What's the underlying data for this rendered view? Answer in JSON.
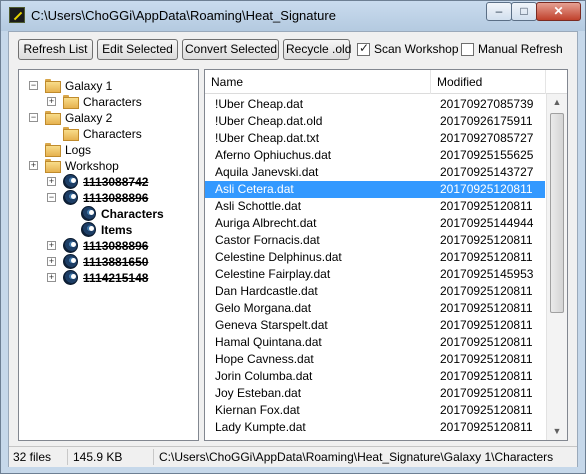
{
  "window": {
    "title": "C:\\Users\\ChoGGi\\AppData\\Roaming\\Heat_Signature",
    "controls": {
      "minimize": "–",
      "maximize": "□",
      "close": "✕"
    }
  },
  "toolbar": {
    "refresh_label": "Refresh List",
    "edit_label": "Edit Selected",
    "convert_label": "Convert Selected",
    "recycle_label": "Recycle .old",
    "scan_workshop": {
      "label": "Scan Workshop",
      "checked": true
    },
    "manual_refresh": {
      "label": "Manual Refresh",
      "checked": false
    }
  },
  "tree": [
    {
      "label": "Galaxy 1",
      "icon": "folder-icon",
      "expander": "−"
    },
    {
      "label": "Characters",
      "icon": "folder-icon",
      "expander": "+"
    },
    {
      "label": "Galaxy 2",
      "icon": "folder-icon",
      "expander": "−"
    },
    {
      "label": "Characters",
      "icon": "folder-icon",
      "expander": ""
    },
    {
      "label": "Logs",
      "icon": "folder-icon",
      "expander": ""
    },
    {
      "label": "Workshop",
      "icon": "folder-icon",
      "expander": "+"
    },
    {
      "label": "1113088742",
      "icon": "steam-icon",
      "expander": "+"
    },
    {
      "label": "1113088896",
      "icon": "steam-icon",
      "expander": "−"
    },
    {
      "label": "Characters",
      "icon": "steam-icon",
      "expander": ""
    },
    {
      "label": "Items",
      "icon": "steam-icon",
      "expander": ""
    },
    {
      "label": "1113088896",
      "icon": "steam-icon",
      "expander": "+"
    },
    {
      "label": "1113881650",
      "icon": "steam-icon",
      "expander": "+"
    },
    {
      "label": "1114215148",
      "icon": "steam-icon",
      "expander": "+"
    }
  ],
  "list": {
    "columns": [
      "Name",
      "Modified"
    ],
    "rows": [
      [
        "!Uber Cheap.dat",
        "20170927085739"
      ],
      [
        "!Uber Cheap.dat.old",
        "20170926175911"
      ],
      [
        "!Uber Cheap.dat.txt",
        "20170927085727"
      ],
      [
        "Aferno Ophiuchus.dat",
        "20170925155625"
      ],
      [
        "Aquila Janevski.dat",
        "20170925143727"
      ],
      [
        "Asli Cetera.dat",
        "20170925120811"
      ],
      [
        "Asli Schottle.dat",
        "20170925120811"
      ],
      [
        "Auriga Albrecht.dat",
        "20170925144944"
      ],
      [
        "Castor Fornacis.dat",
        "20170925120811"
      ],
      [
        "Celestine Delphinus.dat",
        "20170925120811"
      ],
      [
        "Celestine Fairplay.dat",
        "20170925145953"
      ],
      [
        "Dan Hardcastle.dat",
        "20170925120811"
      ],
      [
        "Gelo Morgana.dat",
        "20170925120811"
      ],
      [
        "Geneva Starspelt.dat",
        "20170925120811"
      ],
      [
        "Hamal Quintana.dat",
        "20170925120811"
      ],
      [
        "Hope Cavness.dat",
        "20170925120811"
      ],
      [
        "Jorin Columba.dat",
        "20170925120811"
      ],
      [
        "Joy Esteban.dat",
        "20170925120811"
      ],
      [
        "Kiernan Fox.dat",
        "20170925120811"
      ],
      [
        "Lady Kumpte.dat",
        "20170925120811"
      ]
    ],
    "selected_index": 5
  },
  "status": {
    "files": "32 files",
    "size": "145.9 KB",
    "path": "C:\\Users\\ChoGGi\\AppData\\Roaming\\Heat_Signature\\Galaxy 1\\Characters"
  }
}
